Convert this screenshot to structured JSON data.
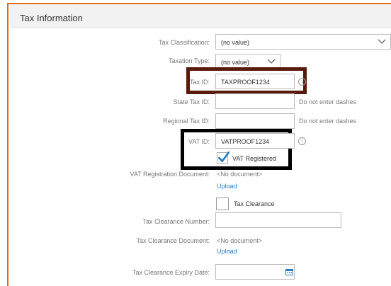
{
  "panel": {
    "title": "Tax Information"
  },
  "fields": {
    "tax_classification": {
      "label": "Tax Classification:",
      "value": "(no value)"
    },
    "taxation_type": {
      "label": "Taxation Type:",
      "value": "(no value)"
    },
    "tax_id": {
      "label": "Tax ID:",
      "value": "TAXPROOF1234"
    },
    "state_tax_id": {
      "label": "State Tax ID:",
      "value": "",
      "note": "Do not enter dashes"
    },
    "regional_tax_id": {
      "label": "Regional Tax ID:",
      "value": "",
      "note": "Do not enter dashes"
    },
    "vat_id": {
      "label": "VAT ID:",
      "value": "VATPROOF1234"
    },
    "vat_registered": {
      "label": "VAT Registered",
      "checked": true
    },
    "vat_registration_document": {
      "label": "VAT Registration Document:",
      "value": "<No document>",
      "action": "Upload"
    },
    "tax_clearance": {
      "label": "Tax Clearance",
      "checked": false
    },
    "tax_clearance_number": {
      "label": "Tax Clearance Number:",
      "value": ""
    },
    "tax_clearance_document": {
      "label": "Tax Clearance Document:",
      "value": "<No document>",
      "action": "Upload"
    },
    "tax_clearance_expiry_date": {
      "label": "Tax Clearance Expiry Date:",
      "value": ""
    }
  },
  "icons": {
    "select_arrow": "chevron-down-icon",
    "info": "info-icon",
    "checkmark": "checkmark-icon",
    "calendar": "calendar-icon"
  },
  "colors": {
    "panel_border": "#e26a1b",
    "tax_id_highlight": "#5a1a0c",
    "vat_highlight": "#000000",
    "checkmark": "#2a7bc0",
    "link": "#2a7bc0"
  }
}
